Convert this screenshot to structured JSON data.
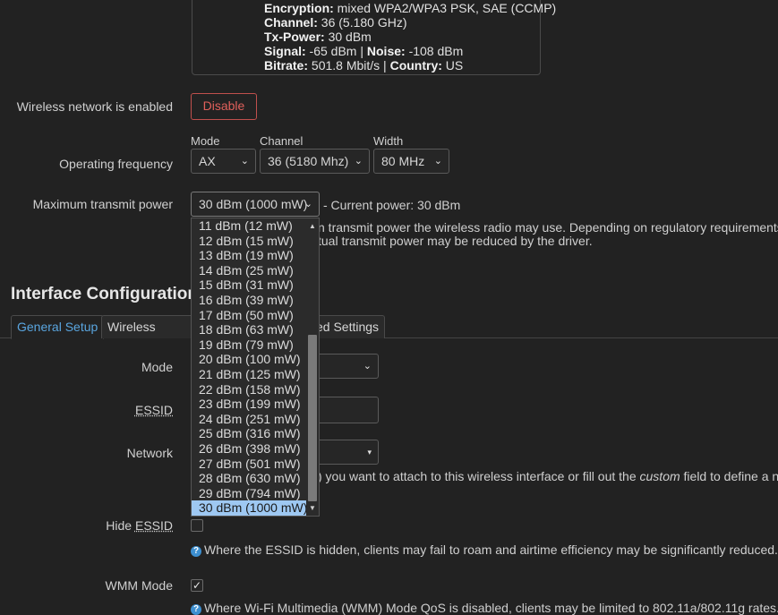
{
  "status": {
    "encryption_label": "Encryption:",
    "encryption_value": " mixed WPA2/WPA3 PSK, SAE (CCMP)",
    "channel_label": "Channel:",
    "channel_value": " 36 (5.180 GHz)",
    "txpower_label": "Tx-Power:",
    "txpower_value": " 30 dBm",
    "signal_label": "Signal:",
    "signal_value": " -65 dBm | ",
    "noise_label": "Noise:",
    "noise_value": " -108 dBm",
    "bitrate_label": "Bitrate:",
    "bitrate_value": " 501.8 Mbit/s | ",
    "country_label": "Country:",
    "country_value": " US"
  },
  "wireless": {
    "enabled_label": "Wireless network is enabled",
    "disable_button": "Disable",
    "freq_label": "Operating frequency",
    "mode_label": "Mode",
    "mode_value": "AX",
    "channel_label": "Channel",
    "channel_value": "36 (5180 Mhz)",
    "width_label": "Width",
    "width_value": "80 MHz",
    "txpower_label": "Maximum transmit power",
    "txpower_value": "30 dBm (1000 mW)",
    "current_power": "- Current power: 30 dBm",
    "txpower_help_1": "n transmit power the wireless radio may use. Depending on regulatory requirements and",
    "txpower_help_2": "tual transmit power may be reduced by the driver."
  },
  "txpower_options": [
    "11 dBm (12 mW)",
    "12 dBm (15 mW)",
    "13 dBm (19 mW)",
    "14 dBm (25 mW)",
    "15 dBm (31 mW)",
    "16 dBm (39 mW)",
    "17 dBm (50 mW)",
    "18 dBm (63 mW)",
    "19 dBm (79 mW)",
    "20 dBm (100 mW)",
    "21 dBm (125 mW)",
    "22 dBm (158 mW)",
    "23 dBm (199 mW)",
    "24 dBm (251 mW)",
    "25 dBm (316 mW)",
    "26 dBm (398 mW)",
    "27 dBm (501 mW)",
    "28 dBm (630 mW)",
    "29 dBm (794 mW)",
    "30 dBm (1000 mW)"
  ],
  "interface": {
    "title": "Interface Configuration",
    "tab_general": "General Setup",
    "tab_security": "Wireless Securit",
    "tab_advanced": "ced Settings",
    "mode_label": "Mode",
    "essid_label": "ESSID",
    "network_label": "Network",
    "network_help_1": ") you want to attach to this wireless interface or fill out the ",
    "network_help_custom": "custom",
    "network_help_2": " field to define a new",
    "hide_essid_label_prefix": "Hide ",
    "hide_essid_label_underlined": "ESSID",
    "hide_essid_help": "Where the ESSID is hidden, clients may fail to roam and airtime efficiency may be significantly reduced.",
    "wmm_label": "WMM Mode",
    "wmm_help": "Where Wi-Fi Multimedia (WMM) Mode QoS is disabled, clients may be limited to 802.11a/802.11g rates."
  },
  "colors": {
    "background": "#222222",
    "accent": "#5aa6e0",
    "danger": "#e0605b",
    "selected_option": "#9ec8f2"
  }
}
